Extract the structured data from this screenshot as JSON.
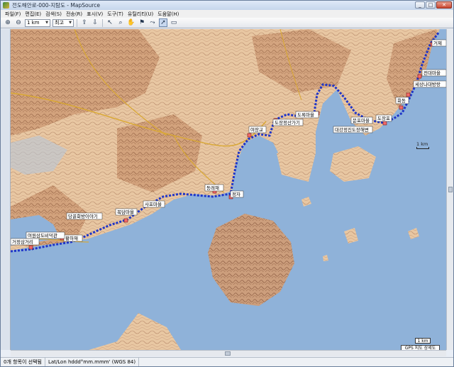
{
  "window": {
    "title": "전도해안로-000-지탐도 - MapSource",
    "min": "_",
    "max": "□",
    "close": "✕"
  },
  "menu": [
    "파일(F)",
    "편집(E)",
    "검색(S)",
    "전송(R)",
    "표시(V)",
    "도구(T)",
    "유틸리티(U)",
    "도움말(H)"
  ],
  "toolbar": {
    "scale_value": "1 km",
    "detail_value": "최고"
  },
  "map": {
    "waypoints": [
      {
        "label": "거제"
      },
      {
        "label": "전대마을"
      },
      {
        "label": "세상나대방랑"
      },
      {
        "label": "회동"
      },
      {
        "label": "도장포"
      },
      {
        "label": "문포마을"
      },
      {
        "label": "대강정진도장해변"
      },
      {
        "label": "도록마을"
      },
      {
        "label": "도장정산가기"
      },
      {
        "label": "여장교"
      },
      {
        "label": "동래재"
      },
      {
        "label": "정자"
      },
      {
        "label": "사포마을"
      },
      {
        "label": "목담마을"
      },
      {
        "label": "당골회방이야기"
      },
      {
        "label": "황하재"
      },
      {
        "label": "여원삼도비덕관"
      },
      {
        "label": "거정삼거리"
      }
    ],
    "scale_label_top": "1 km",
    "scale_label_bottom": "1 km",
    "detail_label": "GPS 지도 상세도"
  },
  "status": {
    "selection": "0개 항목이 선택됨",
    "coord_format": "Lat/Lon hddd°mm.mmm' (WGS 84)"
  },
  "colors": {
    "sea": "#8fb2d9",
    "land": "#e8c7a2",
    "track": "#1f35c9"
  }
}
